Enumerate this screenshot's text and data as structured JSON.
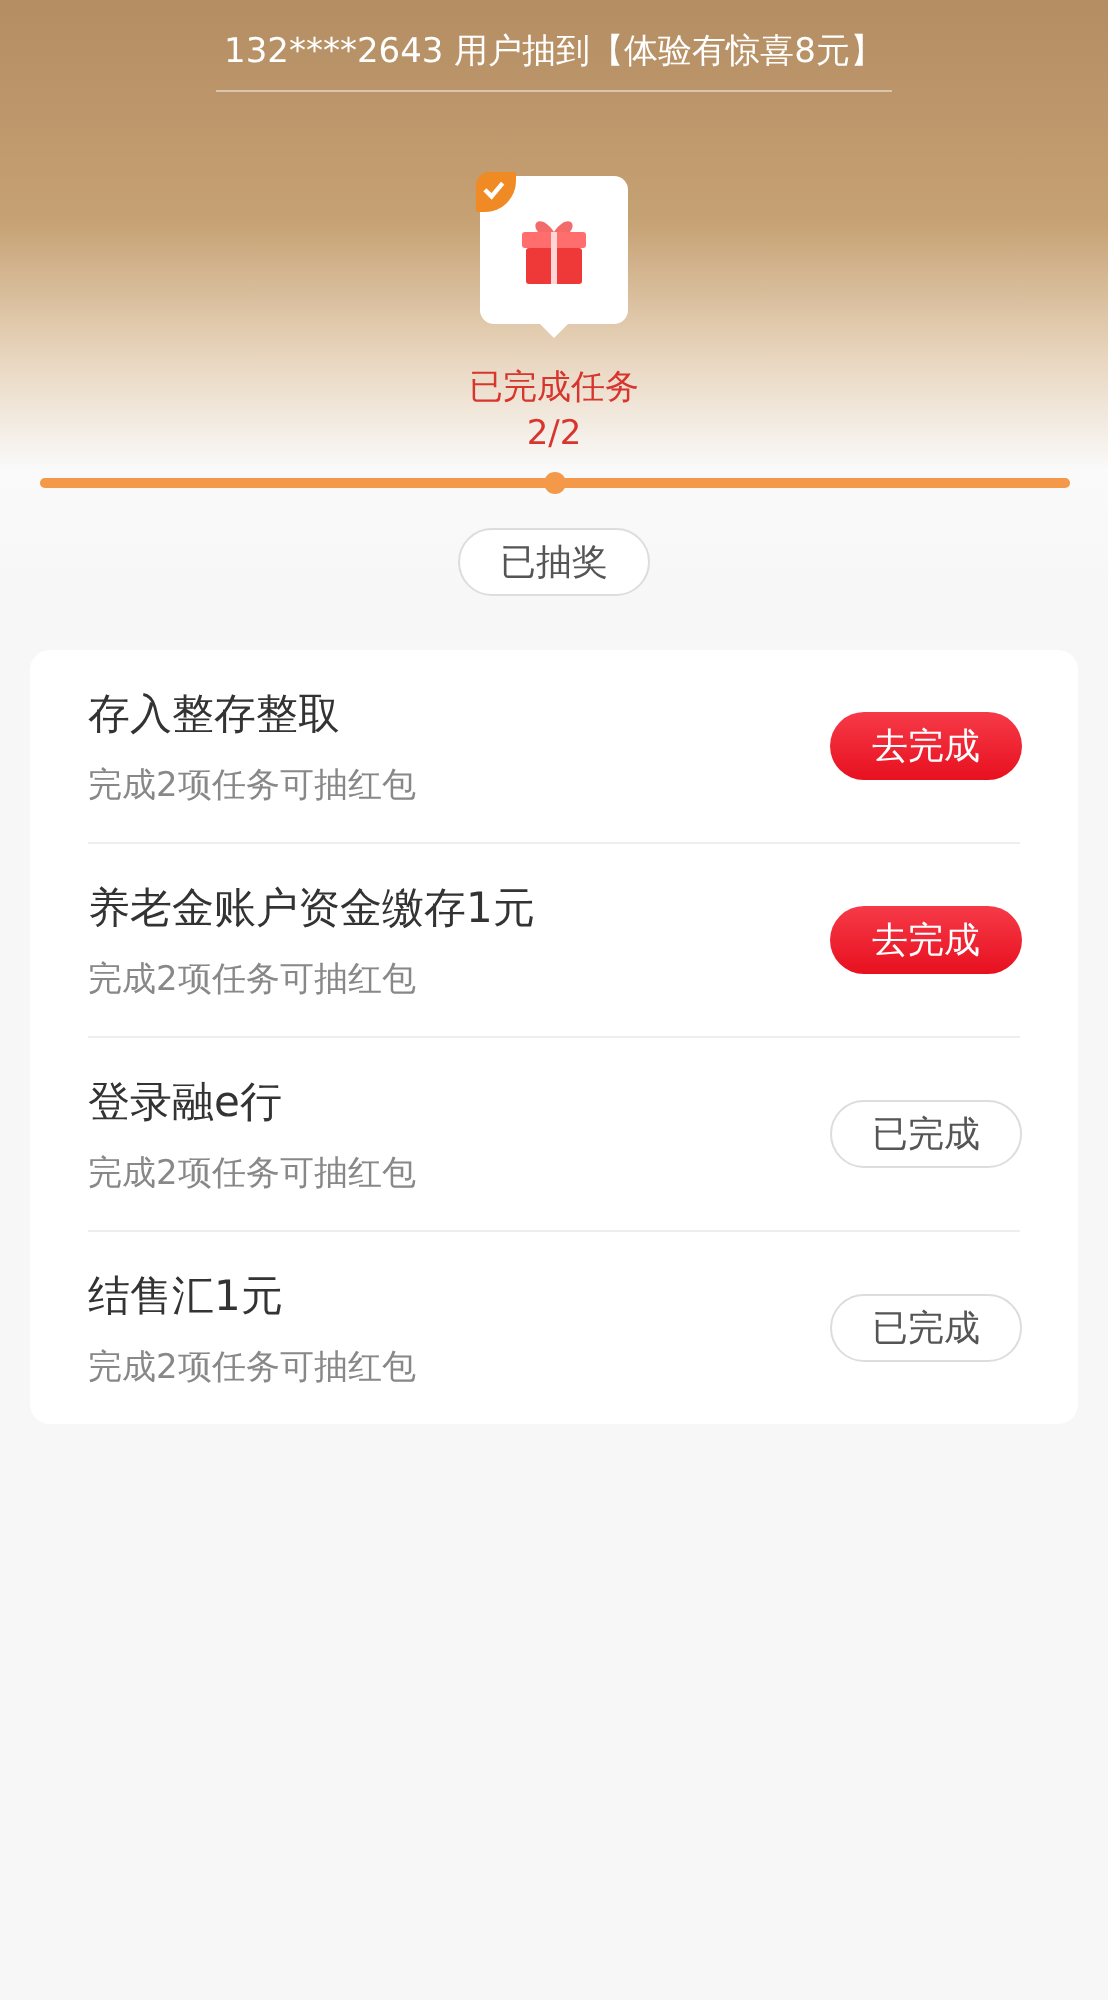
{
  "ticker": "132****2643 用户抽到【体验有惊喜8元】",
  "reward": {
    "completed": true,
    "label": "已完成任务",
    "count": "2/2"
  },
  "progress": {
    "level": 1
  },
  "draw_button": {
    "label": "已抽奖",
    "disabled": true
  },
  "tasks": [
    {
      "title": "存入整存整取",
      "subtitle": "完成2项任务可抽红包",
      "button": "去完成",
      "done": false
    },
    {
      "title": "养老金账户资金缴存1元",
      "subtitle": "完成2项任务可抽红包",
      "button": "去完成",
      "done": false
    },
    {
      "title": "登录融e行",
      "subtitle": "完成2项任务可抽红包",
      "button": "已完成",
      "done": true
    },
    {
      "title": "结售汇1元",
      "subtitle": "完成2项任务可抽红包",
      "button": "已完成",
      "done": true
    }
  ]
}
